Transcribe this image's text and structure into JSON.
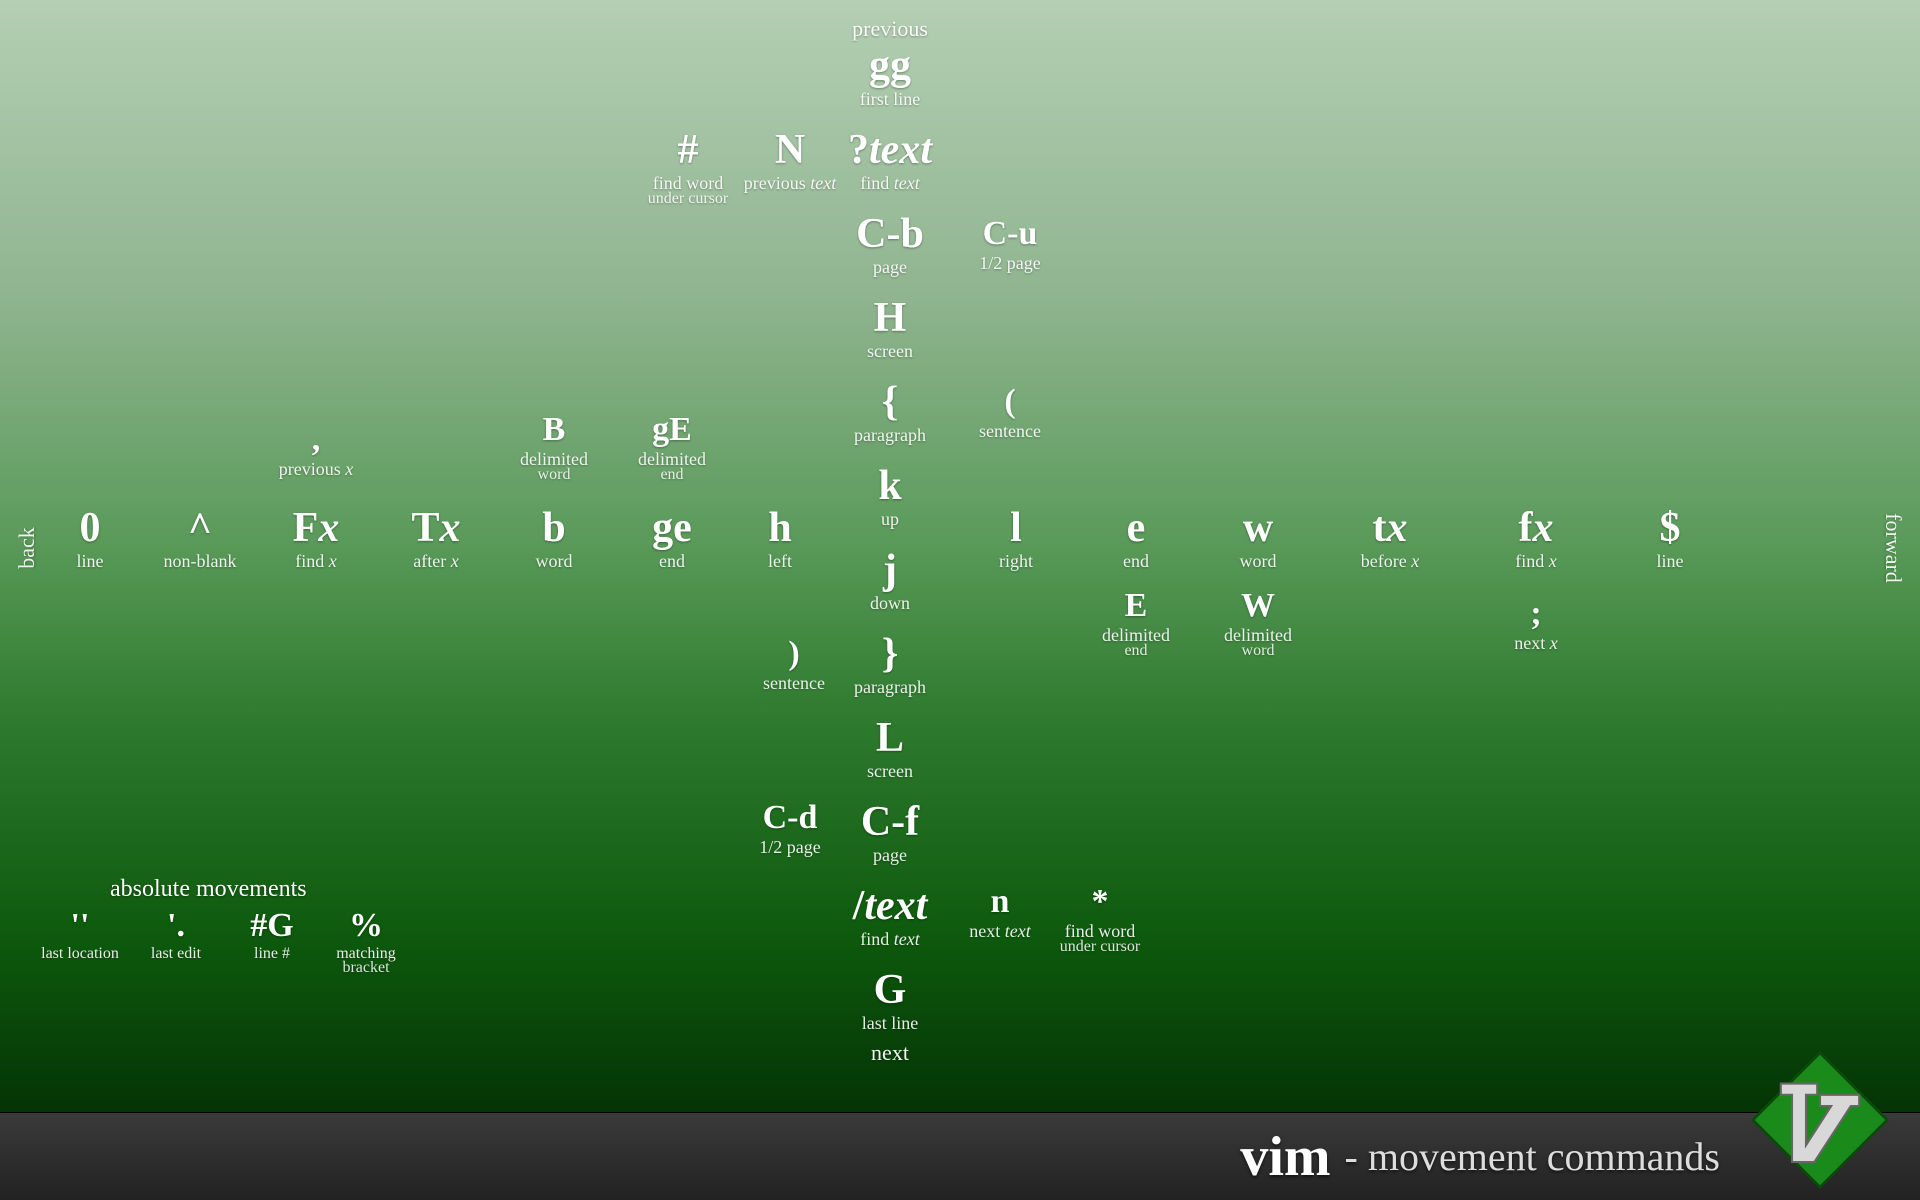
{
  "title": {
    "vim": "vim",
    "sub": "- movement commands"
  },
  "labels": {
    "previous": "previous",
    "next": "next",
    "back": "back",
    "forward": "forward",
    "absolute": "absolute movements"
  },
  "vcol": {
    "gg": {
      "k": "gg",
      "d": "first line"
    },
    "qtext": {
      "k": "?",
      "ki": "text",
      "d": "find ",
      "di": "text"
    },
    "cb": {
      "k": "C-b",
      "d": "page"
    },
    "H": {
      "k": "H",
      "d": "screen"
    },
    "lb": {
      "k": "{",
      "d": "paragraph"
    },
    "k": {
      "k": "k",
      "d": "up"
    },
    "j": {
      "k": "j",
      "d": "down"
    },
    "rb": {
      "k": "}",
      "d": "paragraph"
    },
    "L": {
      "k": "L",
      "d": "screen"
    },
    "cf": {
      "k": "C-f",
      "d": "page"
    },
    "stext": {
      "k": "/",
      "ki": "text",
      "d": "find ",
      "di": "text"
    },
    "G": {
      "k": "G",
      "d": "last line"
    }
  },
  "vside": {
    "hash": {
      "k": "#",
      "d": "find word",
      "d2": "under cursor"
    },
    "N": {
      "k": "N",
      "d": "previous ",
      "di": "text"
    },
    "cu": {
      "k": "C-u",
      "d": "1/2 page"
    },
    "lp": {
      "k": "(",
      "d": "sentence"
    },
    "rp": {
      "k": ")",
      "d": "sentence"
    },
    "cd": {
      "k": "C-d",
      "d": "1/2 page"
    },
    "n": {
      "k": "n",
      "d": "next ",
      "di": "text"
    },
    "star": {
      "k": "*",
      "d": "find word",
      "d2": "under cursor"
    }
  },
  "hrow": {
    "zero": {
      "k": "0",
      "d": "line"
    },
    "caret": {
      "k": "^",
      "d": "non-blank"
    },
    "Fx": {
      "k": "F",
      "ki": "x",
      "d": "find ",
      "di": "x"
    },
    "Tx": {
      "k": "T",
      "ki": "x",
      "d": "after ",
      "di": "x"
    },
    "b": {
      "k": "b",
      "d": "word"
    },
    "ge": {
      "k": "ge",
      "d": "end"
    },
    "h": {
      "k": "h",
      "d": "left"
    },
    "l": {
      "k": "l",
      "d": "right"
    },
    "e": {
      "k": "e",
      "d": "end"
    },
    "w": {
      "k": "w",
      "d": "word"
    },
    "tx": {
      "k": "t",
      "ki": "x",
      "d": "before ",
      "di": "x"
    },
    "fx": {
      "k": "f",
      "ki": "x",
      "d": "find ",
      "di": "x"
    },
    "dol": {
      "k": "$",
      "d": "line"
    }
  },
  "hside": {
    "comma": {
      "k": ",",
      "d": "previous ",
      "di": "x"
    },
    "B": {
      "k": "B",
      "d": "delimited",
      "d2": "word"
    },
    "gE": {
      "k": "gE",
      "d": "delimited",
      "d2": "end"
    },
    "E": {
      "k": "E",
      "d": "delimited",
      "d2": "end"
    },
    "W": {
      "k": "W",
      "d": "delimited",
      "d2": "word"
    },
    "semi": {
      "k": ";",
      "d": "next ",
      "di": "x"
    }
  },
  "abs": {
    "tick": {
      "k": "''",
      "d": "last location"
    },
    "dot": {
      "k": "'.",
      "d": "last edit"
    },
    "numG": {
      "k": "#G",
      "d": "line #"
    },
    "pct": {
      "k": "%",
      "d": "matching",
      "d2": "bracket"
    }
  }
}
